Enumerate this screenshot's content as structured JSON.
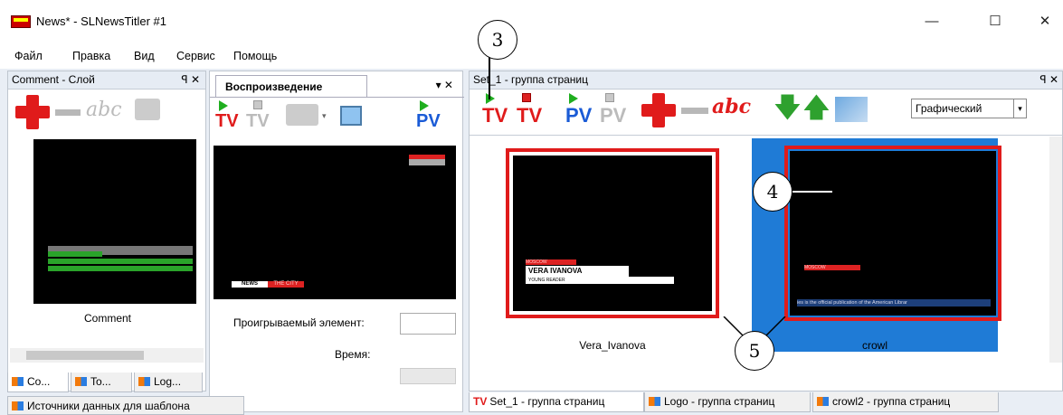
{
  "window": {
    "title": "News* - SLNewsTitler #1",
    "minimize": "—",
    "maximize": "☐",
    "close": "✕"
  },
  "menu": [
    "Файл",
    "Правка",
    "Вид",
    "Сервис",
    "Помощь"
  ],
  "comment_panel": {
    "title": "Comment - Слой",
    "pin": "ꟼ ✕",
    "item_label": "Comment",
    "tabs": [
      "Co...",
      "To...",
      "Log..."
    ],
    "abc": "abc"
  },
  "playback_panel": {
    "tab": "Воспроизведение",
    "pin": "▾ ✕",
    "tv": "TV",
    "pv": "PV",
    "played_label": "Проигрываемый элемент:",
    "time_label": "Время:",
    "preview_badge": "NEWS",
    "preview_tag": "THE CITY"
  },
  "set_panel": {
    "title": "Set_1 - группа страниц",
    "pin": "ꟼ ✕",
    "tv": "TV",
    "pv": "PV",
    "abc": "abc",
    "mode_select": "Графический",
    "pages": [
      {
        "label": "Vera_Ivanova",
        "tag": "MOSCOW",
        "name": "VERA IVANOVA",
        "sub": "YOUNG READER"
      },
      {
        "label": "crowl",
        "tag": "MOSCOW",
        "crawl": "ies is the official publication of the American Librar"
      }
    ],
    "tabs": [
      {
        "icon": "TV",
        "label": "Set_1 - группа страниц"
      },
      {
        "label": "Logo - группа страниц"
      },
      {
        "label": "crowl2 - группа страниц"
      }
    ]
  },
  "status_tab": "Источники данных для шаблона",
  "callouts": [
    "3",
    "4",
    "5"
  ],
  "colors": {
    "accent_red": "#e01b1b",
    "selected_bg": "#1f7bd6",
    "play_green": "#1fae1f"
  }
}
